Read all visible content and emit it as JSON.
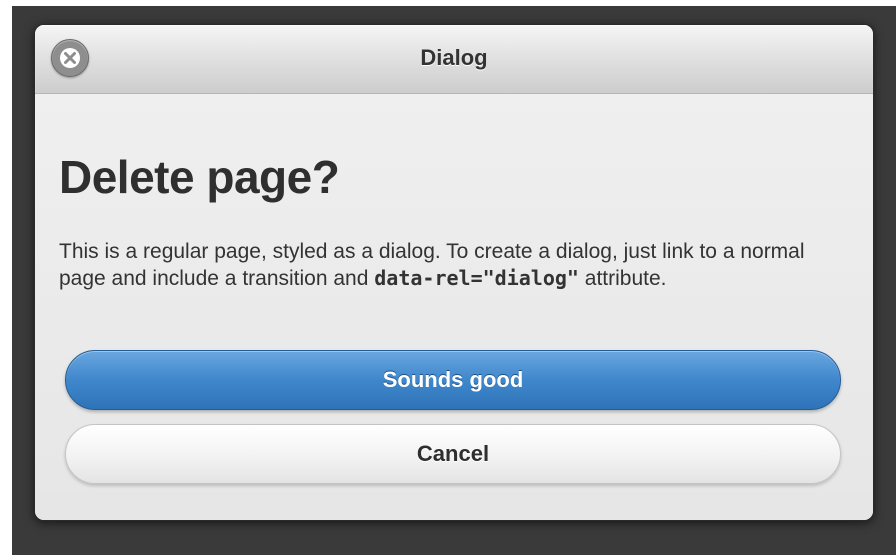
{
  "dialog": {
    "title": "Dialog",
    "close_icon": "close-icon"
  },
  "content": {
    "heading": "Delete page?",
    "description_part1": "This is a regular page, styled as a dialog. To create a dialog, just link to a normal page and include a transition and ",
    "description_code": "data-rel=\"dialog\"",
    "description_part2": " attribute."
  },
  "buttons": {
    "primary_label": "Sounds good",
    "secondary_label": "Cancel"
  },
  "colors": {
    "primary_button": "#3f87cc",
    "backdrop": "#3a3a3a"
  }
}
